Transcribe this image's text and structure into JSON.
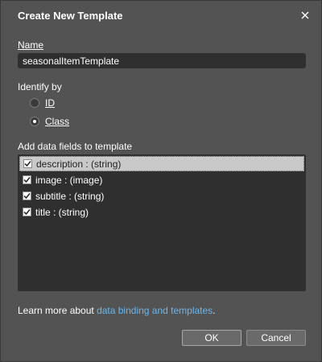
{
  "dialog": {
    "title": "Create New Template",
    "close_icon": "close-icon"
  },
  "name_section": {
    "label": "Name",
    "value": "seasonalItemTemplate"
  },
  "identify": {
    "label": "Identify by",
    "options": [
      {
        "label": "ID",
        "checked": false
      },
      {
        "label": "Class",
        "checked": true
      }
    ]
  },
  "fields": {
    "label": "Add data fields to template",
    "items": [
      {
        "label": "description : (string)",
        "checked": true,
        "selected": true
      },
      {
        "label": "image : (image)",
        "checked": true,
        "selected": false
      },
      {
        "label": "subtitle : (string)",
        "checked": true,
        "selected": false
      },
      {
        "label": "title : (string)",
        "checked": true,
        "selected": false
      }
    ]
  },
  "footer": {
    "prefix": "Learn more about ",
    "link": "data binding and templates",
    "suffix": "."
  },
  "buttons": {
    "ok": "OK",
    "cancel": "Cancel"
  },
  "colors": {
    "background": "#535353",
    "input": "#2f2f2f",
    "link": "#6ab7ee",
    "selection": "#c9c9c9"
  }
}
